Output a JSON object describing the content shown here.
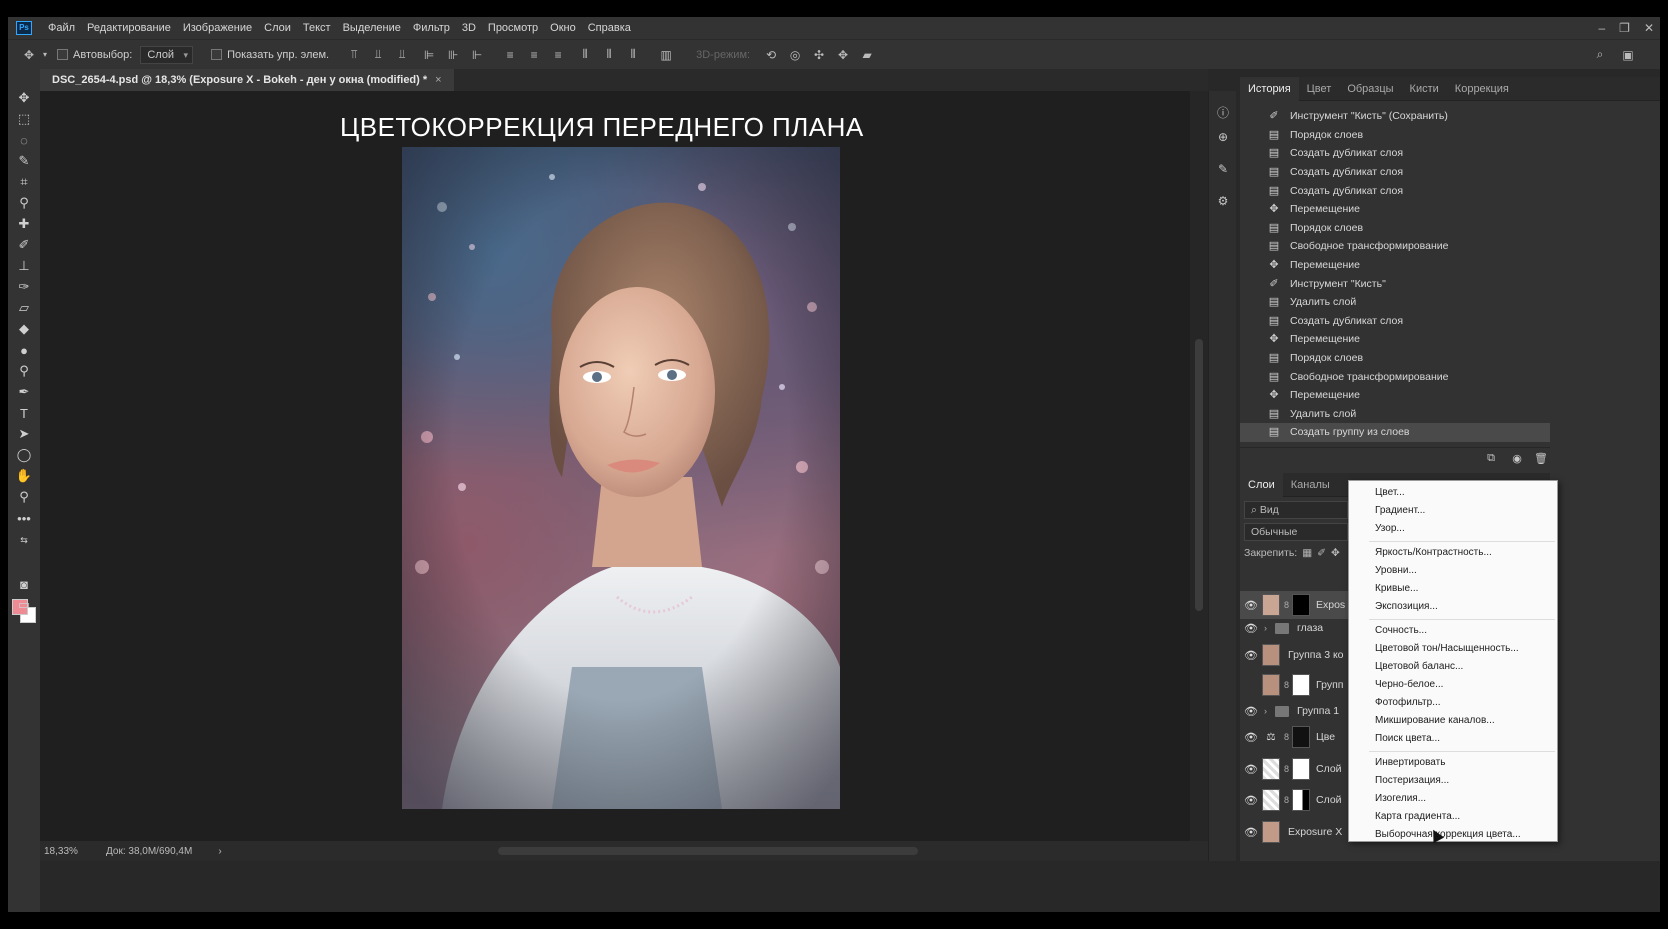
{
  "app": {
    "logo": "Ps"
  },
  "menu": [
    "Файл",
    "Редактирование",
    "Изображение",
    "Слои",
    "Текст",
    "Выделение",
    "Фильтр",
    "3D",
    "Просмотр",
    "Окно",
    "Справка"
  ],
  "options": {
    "autoselect_label": "Автовыбор:",
    "autoselect_value": "Слой",
    "show_controls_label": "Показать упр. элем.",
    "mode_3d_label": "3D-режим:"
  },
  "document": {
    "tab_title": "DSC_2654-4.psd @ 18,3% (Exposure X - Bokeh - ден у окна (modified) *",
    "tab_close": "×",
    "heading": "ЦВЕТОКОРРЕКЦИЯ ПЕРЕДНЕГО ПЛАНА"
  },
  "status": {
    "zoom": "18,33%",
    "doc": "Док: 38,0M/690,4M",
    "arrow": "›"
  },
  "panel_tabs": [
    "История",
    "Цвет",
    "Образцы",
    "Кисти",
    "Коррекция"
  ],
  "history": [
    {
      "icon": "brush-icon",
      "label": "Инструмент \"Кисть\" (Сохранить)"
    },
    {
      "icon": "doc-icon",
      "label": "Порядок слоев"
    },
    {
      "icon": "doc-icon",
      "label": "Создать дубликат слоя"
    },
    {
      "icon": "doc-icon",
      "label": "Создать дубликат слоя"
    },
    {
      "icon": "doc-icon",
      "label": "Создать дубликат слоя"
    },
    {
      "icon": "move-icon",
      "label": "Перемещение"
    },
    {
      "icon": "doc-icon",
      "label": "Порядок слоев"
    },
    {
      "icon": "doc-icon",
      "label": "Свободное трансформирование"
    },
    {
      "icon": "move-icon",
      "label": "Перемещение"
    },
    {
      "icon": "brush-icon",
      "label": "Инструмент \"Кисть\""
    },
    {
      "icon": "doc-icon",
      "label": "Удалить слой"
    },
    {
      "icon": "doc-icon",
      "label": "Создать дубликат слоя"
    },
    {
      "icon": "move-icon",
      "label": "Перемещение"
    },
    {
      "icon": "doc-icon",
      "label": "Порядок слоев"
    },
    {
      "icon": "doc-icon",
      "label": "Свободное трансформирование"
    },
    {
      "icon": "move-icon",
      "label": "Перемещение"
    },
    {
      "icon": "doc-icon",
      "label": "Удалить слой"
    },
    {
      "icon": "doc-icon",
      "label": "Создать группу из слоев"
    }
  ],
  "layer_tabs": [
    "Слои",
    "Каналы"
  ],
  "layers_panel": {
    "search": "Вид",
    "blend_mode": "Обычные",
    "lock_label": "Закрепить:"
  },
  "layers": [
    {
      "name": "Expos",
      "type": "adjust"
    },
    {
      "name": "глаза",
      "type": "group"
    },
    {
      "name": "Группа 3 ко",
      "type": "pixel"
    },
    {
      "name": "Групп",
      "type": "adjust"
    },
    {
      "name": "Группа 1",
      "type": "group"
    },
    {
      "name": "Цве",
      "type": "balance"
    },
    {
      "name": "Слой",
      "type": "adjust"
    },
    {
      "name": "Слой",
      "type": "adjust"
    },
    {
      "name": "Exposure X",
      "type": "pixel"
    }
  ],
  "context_menu": [
    [
      "Цвет...",
      "Градиент...",
      "Узор..."
    ],
    [
      "Яркость/Контрастность...",
      "Уровни...",
      "Кривые...",
      "Экспозиция..."
    ],
    [
      "Сочность...",
      "Цветовой тон/Насыщенность...",
      "Цветовой баланс...",
      "Черно-белое...",
      "Фотофильтр...",
      "Микширование каналов...",
      "Поиск цвета..."
    ],
    [
      "Инвертировать",
      "Постеризация...",
      "Изогелия...",
      "Карта градиента...",
      "Выборочная коррекция цвета..."
    ]
  ],
  "colors": {
    "foreground": "#ef8b94",
    "background": "#ffffff",
    "app_bg": "#282828"
  }
}
